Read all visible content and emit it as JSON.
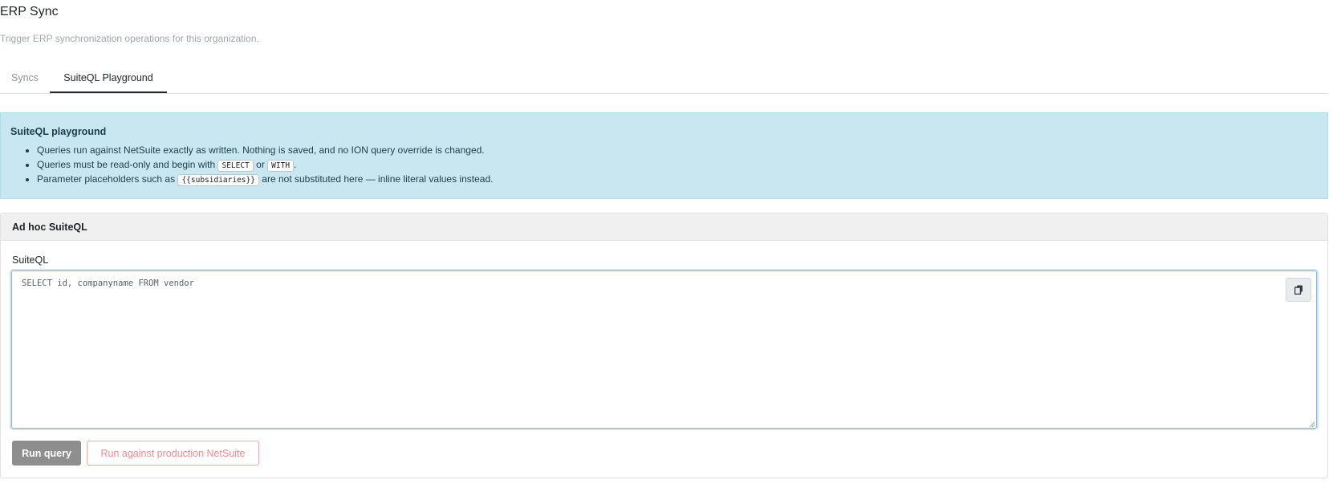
{
  "header": {
    "title": "ERP Sync",
    "subtitle": "Trigger ERP synchronization operations for this organization."
  },
  "tabs": [
    {
      "label": "Syncs",
      "active": false
    },
    {
      "label": "SuiteQL Playground",
      "active": true
    }
  ],
  "info": {
    "title": "SuiteQL playground",
    "bullet1": "Queries run against NetSuite exactly as written. Nothing is saved, and no ION query override is changed.",
    "bullet2_prefix": "Queries must be read-only and begin with",
    "bullet2_code1": "SELECT",
    "bullet2_or": "or",
    "bullet2_code2": "WITH",
    "bullet2_suffix": ".",
    "bullet3_prefix": "Parameter placeholders such as",
    "bullet3_code": "{{subsidiaries}}",
    "bullet3_suffix": "are not substituted here — inline literal values instead."
  },
  "card": {
    "header": "Ad hoc SuiteQL",
    "field_label": "SuiteQL",
    "editor_placeholder": "SELECT id, companyname FROM vendor",
    "editor_value": "",
    "copy_icon": "copy-icon"
  },
  "actions": {
    "run_label": "Run query",
    "prod_label": "Run against production NetSuite"
  },
  "colors": {
    "info_bg": "#c8e7f1",
    "run_button": "#8e8e8e",
    "prod_button_text": "#f08c8f",
    "active_tab_border": "#212529"
  }
}
